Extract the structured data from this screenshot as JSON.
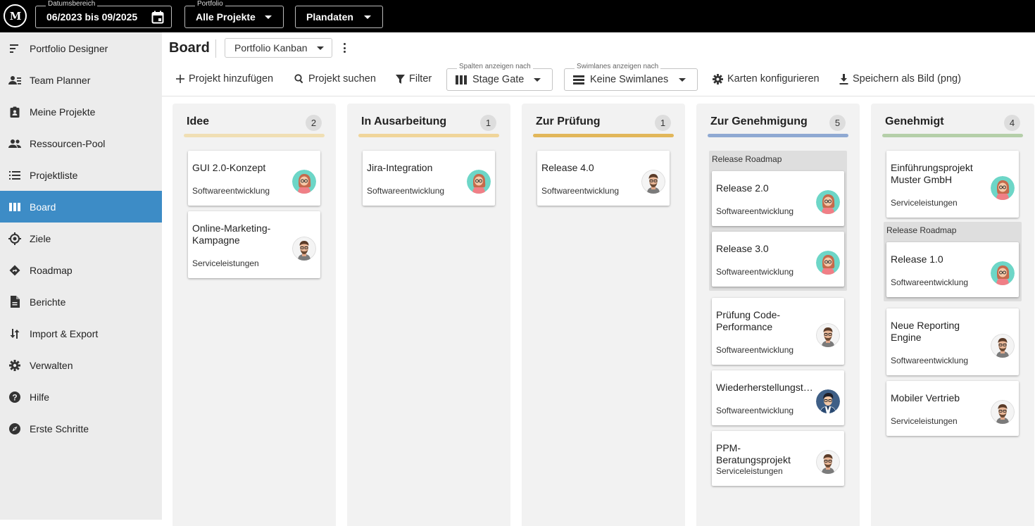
{
  "topbar": {
    "logo_text": "M",
    "date_range": {
      "legend": "Datumsbereich",
      "value": "06/2023 bis 09/2025"
    },
    "portfolio": {
      "legend": "Portfolio",
      "value": "Alle Projekte"
    },
    "plan": {
      "value": "Plandaten"
    }
  },
  "sidebar": {
    "items": [
      {
        "label": "Portfolio Designer",
        "icon": "portfolio-designer-icon"
      },
      {
        "label": "Team Planner",
        "icon": "team-planner-icon"
      },
      {
        "label": "Meine Projekte",
        "icon": "my-projects-icon"
      },
      {
        "label": "Ressourcen-Pool",
        "icon": "resource-pool-icon"
      },
      {
        "label": "Projektliste",
        "icon": "list-icon"
      },
      {
        "label": "Board",
        "icon": "board-icon",
        "active": true
      },
      {
        "label": "Ziele",
        "icon": "target-icon"
      },
      {
        "label": "Roadmap",
        "icon": "roadmap-icon"
      },
      {
        "label": "Berichte",
        "icon": "report-icon"
      },
      {
        "label": "Import & Export",
        "icon": "import-export-icon"
      },
      {
        "label": "Verwalten",
        "icon": "gear-icon"
      },
      {
        "label": "Hilfe",
        "icon": "help-icon"
      },
      {
        "label": "Erste Schritte",
        "icon": "compass-icon"
      }
    ]
  },
  "header": {
    "title": "Board",
    "view_select": "Portfolio Kanban",
    "toolbar": {
      "add_project": "Projekt hinzufügen",
      "search_project": "Projekt suchen",
      "filter": "Filter",
      "columns": {
        "legend": "Spalten anzeigen nach",
        "value": "Stage Gate"
      },
      "swimlanes": {
        "legend": "Swimlanes anzeigen nach",
        "value": "Keine Swimlanes"
      },
      "configure_cards": "Karten konfigurieren",
      "save_image": "Speichern als Bild (png)"
    }
  },
  "board": {
    "columns": [
      {
        "title": "Idee",
        "count": "2",
        "color": "#f0dfb4",
        "cards": [
          {
            "title": "GUI 2.0-Konzept",
            "sub": "Softwareentwicklung",
            "avatar": "woman"
          },
          {
            "title": "Online-Marketing-Kampagne",
            "sub": "Serviceleistungen",
            "avatar": "man"
          }
        ]
      },
      {
        "title": "In Ausarbeitung",
        "count": "1",
        "color": "#f0d59a",
        "cards": [
          {
            "title": "Jira-Integration",
            "sub": "Softwareentwicklung",
            "avatar": "woman"
          }
        ]
      },
      {
        "title": "Zur Prüfung",
        "count": "1",
        "color": "#e2b75a",
        "cards": [
          {
            "title": "Release 4.0",
            "sub": "Softwareentwicklung",
            "avatar": "man"
          }
        ]
      },
      {
        "title": "Zur Genehmigung",
        "count": "5",
        "color": "#8fa9d2",
        "group_label": "Release Roadmap",
        "group_cards": [
          {
            "title": "Release 2.0",
            "sub": "Softwareentwicklung",
            "avatar": "woman"
          },
          {
            "title": "Release 3.0",
            "sub": "Softwareentwicklung",
            "avatar": "woman"
          }
        ],
        "cards": [
          {
            "title": "Prüfung Code-Performance",
            "sub": "Softwareentwicklung",
            "avatar": "man"
          },
          {
            "title": "Wiederherstellungst…",
            "sub": "Softwareentwicklung",
            "avatar": "man-blue"
          },
          {
            "title": "PPM-Beratungsprojekt",
            "sub": "Serviceleistungen",
            "avatar": "man"
          }
        ]
      },
      {
        "title": "Genehmigt",
        "count": "4",
        "color": "#b5cfa9",
        "group_label": "Release Roadmap",
        "cards_before": [
          {
            "title": "Einführungsprojekt Muster GmbH",
            "sub": "Serviceleistungen",
            "avatar": "woman"
          }
        ],
        "group_cards": [
          {
            "title": "Release 1.0",
            "sub": "Softwareentwicklung",
            "avatar": "woman"
          }
        ],
        "cards": [
          {
            "title": "Neue Reporting Engine",
            "sub": "Softwareentwicklung",
            "avatar": "man"
          },
          {
            "title": "Mobiler Vertrieb",
            "sub": "Serviceleistungen",
            "avatar": "man"
          }
        ]
      }
    ]
  }
}
